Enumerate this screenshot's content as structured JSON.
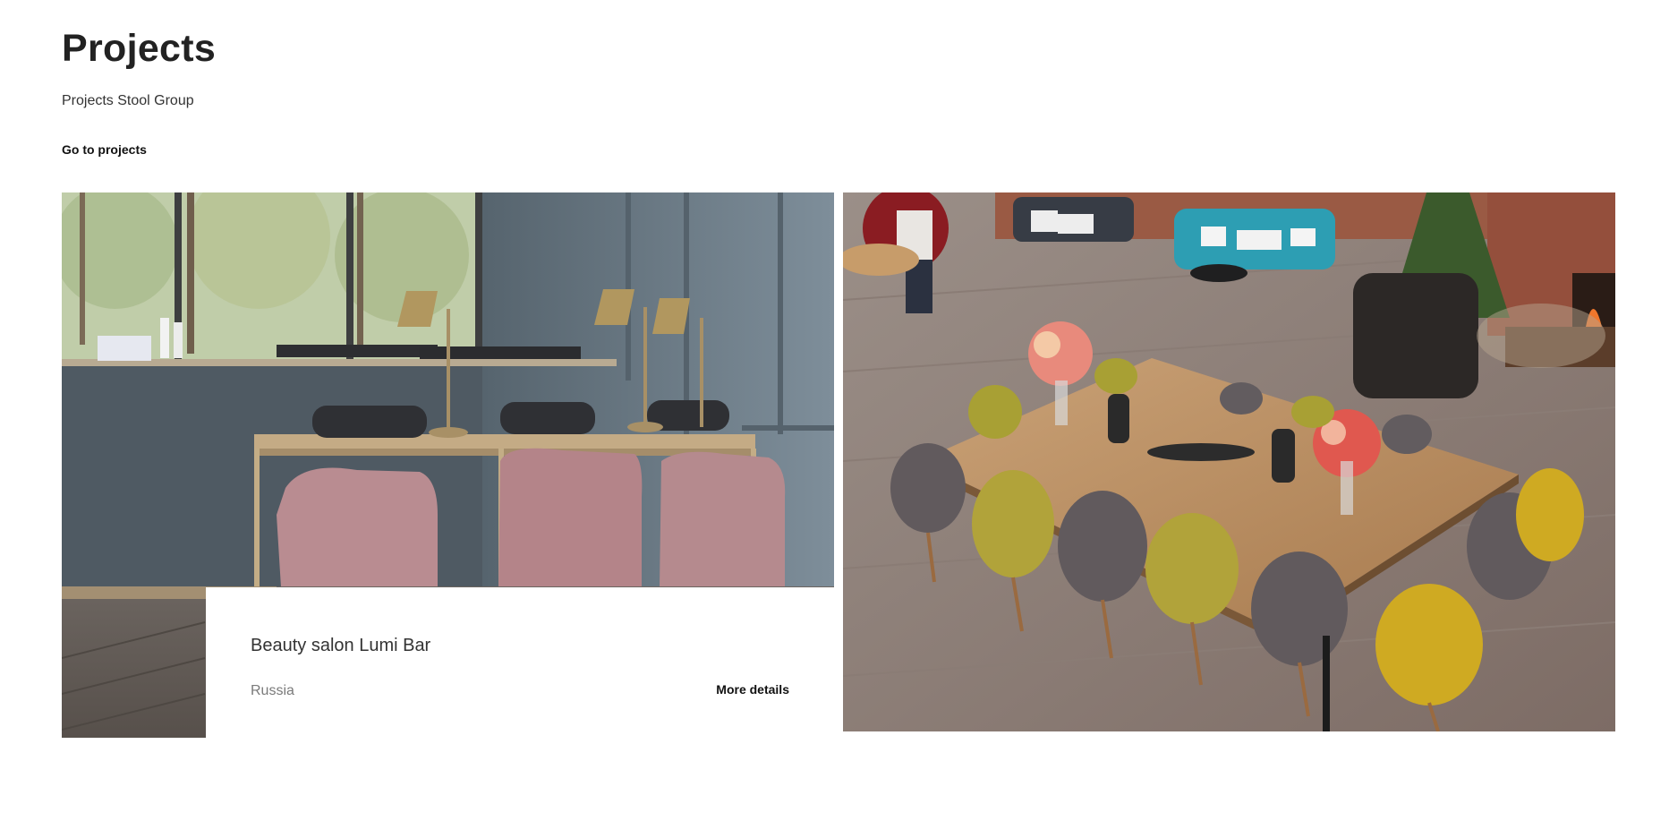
{
  "header": {
    "title": "Projects",
    "subtitle": "Projects Stool Group",
    "goto_label": "Go to projects"
  },
  "projects": [
    {
      "name": "Beauty salon Lumi Bar",
      "country": "Russia",
      "more_label": "More details"
    },
    {
      "name": "",
      "country": "",
      "more_label": ""
    }
  ]
}
